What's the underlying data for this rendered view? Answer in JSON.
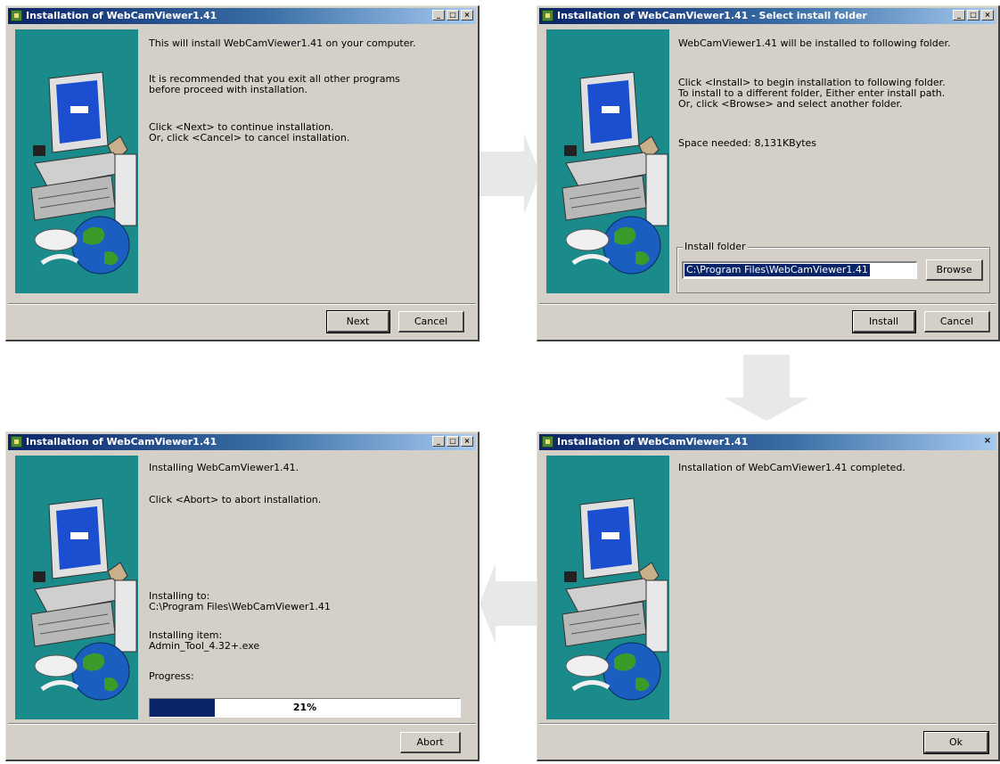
{
  "windows": [
    {
      "title": "Installation of WebCamViewer1.41",
      "lines": [
        "This will install WebCamViewer1.41 on your computer.",
        "It is recommended that you exit all other programs",
        "before proceed with installation.",
        "Click <Next> to continue installation.",
        "Or, click <Cancel> to cancel installation."
      ],
      "buttons": {
        "next": "Next",
        "cancel": "Cancel"
      }
    },
    {
      "title": "Installation of WebCamViewer1.41 - Select install folder",
      "lines": [
        "WebCamViewer1.41 will be installed to following folder.",
        "Click <Install> to begin installation to following folder.",
        "To install to a different folder, Either enter install path.",
        "Or, click <Browse> and select another folder.",
        "Space needed: 8,131KBytes"
      ],
      "group_label": "Install folder",
      "folder_value": "C:\\Program Files\\WebCamViewer1.41",
      "buttons": {
        "browse": "Browse",
        "install": "Install",
        "cancel": "Cancel"
      }
    },
    {
      "title": "Installation of WebCamViewer1.41",
      "lines": [
        "Installing WebCamViewer1.41.",
        "Click <Abort> to abort installation.",
        "Installing to:",
        "C:\\Program Files\\WebCamViewer1.41",
        "Installing item:",
        "Admin_Tool_4.32+.exe",
        "Progress:"
      ],
      "progress": {
        "percent": 21,
        "label": "21%"
      },
      "buttons": {
        "abort": "Abort"
      }
    },
    {
      "title": "Installation of WebCamViewer1.41",
      "lines": [
        "Installation of WebCamViewer1.41 completed."
      ],
      "buttons": {
        "ok": "Ok"
      }
    }
  ],
  "colors": {
    "panel": "#1a8a8a",
    "arrow": "#e8e8e8",
    "titlebar": "#0a246a"
  }
}
